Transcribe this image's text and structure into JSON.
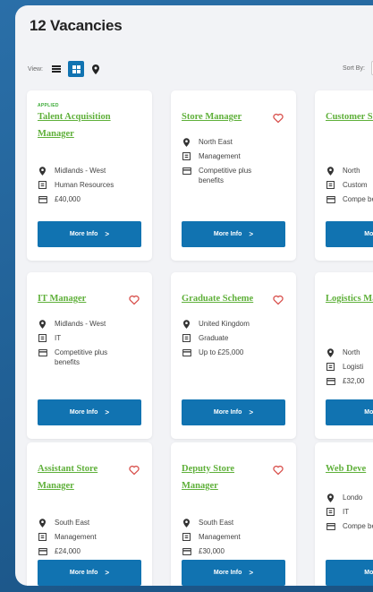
{
  "page": {
    "title": "12 Vacancies"
  },
  "view": {
    "label": "View:",
    "modes": [
      "list-icon",
      "grid-icon",
      "map-pin-icon"
    ],
    "active": "grid-icon"
  },
  "sort": {
    "label": "Sort By:"
  },
  "colors": {
    "accent": "#1173b1",
    "title_green": "#5fb03a",
    "heart": "#d9534f",
    "applied_green": "#3aaa35"
  },
  "jobs": [
    {
      "tag": "APPLIED",
      "title": "Talent Acquisition Manager",
      "location": "Midlands - West",
      "category": "Human Resources",
      "salary": "£40,000",
      "button": "More Info",
      "saved_icon": false
    },
    {
      "tag": "",
      "title": "Store Manager",
      "location": "North East",
      "category": "Management",
      "salary": "Competitive plus benefits",
      "button": "More Info",
      "saved_icon": true
    },
    {
      "tag": "",
      "title": "Customer Service A",
      "location": "North",
      "category": "Custom",
      "salary": "Compe benefit",
      "button": "More",
      "saved_icon": false
    },
    {
      "tag": "",
      "title": "IT Manager",
      "location": "Midlands - West",
      "category": "IT",
      "salary": "Competitive plus benefits",
      "button": "More Info",
      "saved_icon": true
    },
    {
      "tag": "",
      "title": "Graduate Scheme",
      "location": "United Kingdom",
      "category": "Graduate",
      "salary": "Up to £25,000",
      "button": "More Info",
      "saved_icon": true
    },
    {
      "tag": "",
      "title": "Logistics Manager",
      "location": "North",
      "category": "Logisti",
      "salary": "£32,00",
      "button": "More",
      "saved_icon": false
    },
    {
      "tag": "",
      "title": "Assistant Store Manager",
      "location": "South East",
      "category": "Management",
      "salary": "£24,000",
      "button": "More Info",
      "saved_icon": true
    },
    {
      "tag": "",
      "title": "Deputy Store Manager",
      "location": "South East",
      "category": "Management",
      "salary": "£30,000",
      "button": "More Info",
      "saved_icon": true
    },
    {
      "tag": "",
      "title": "Web Deve",
      "location": "Londo",
      "category": "IT",
      "salary": "Compe benefi",
      "button": "More",
      "saved_icon": false
    }
  ]
}
